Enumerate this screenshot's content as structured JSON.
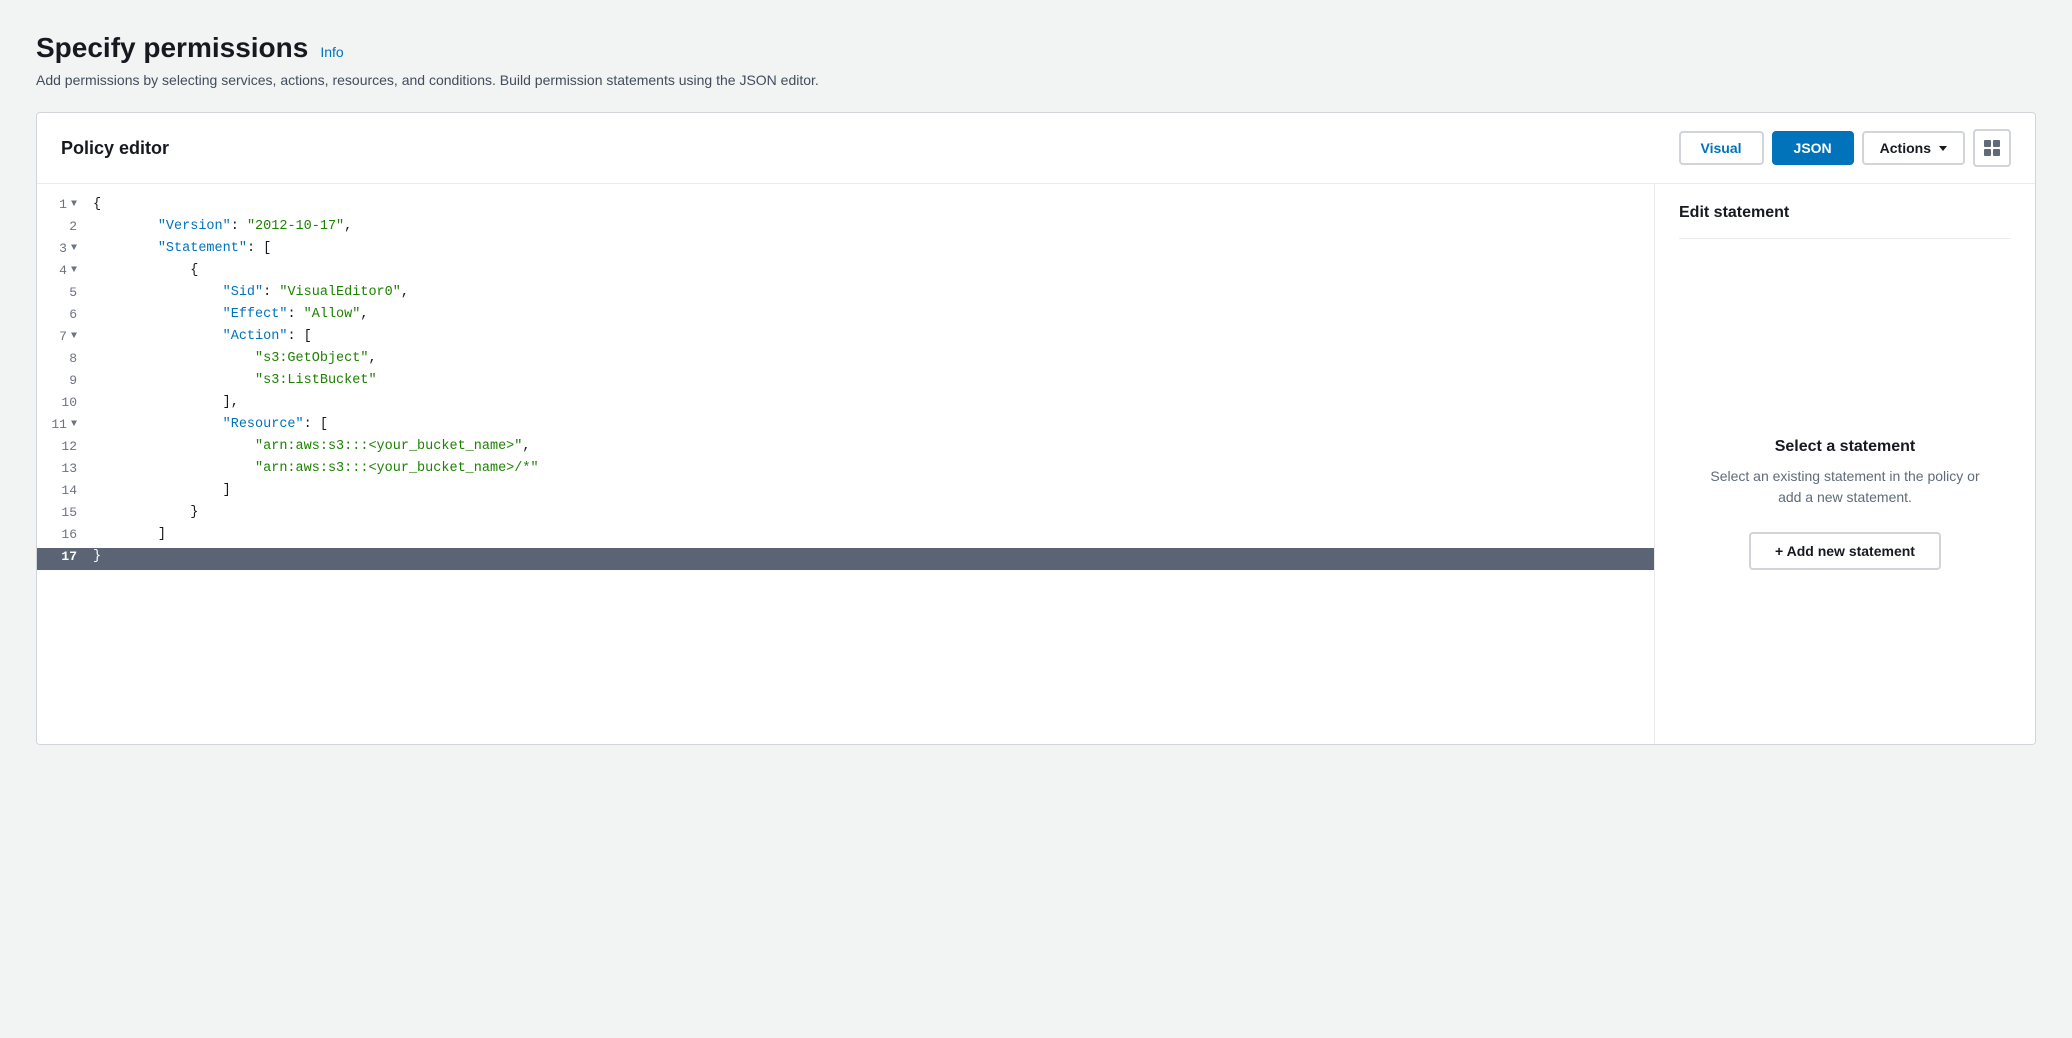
{
  "page": {
    "title": "Specify permissions",
    "info_link": "Info",
    "subtitle": "Add permissions by selecting services, actions, resources, and conditions. Build permission statements using the JSON editor."
  },
  "editor": {
    "title": "Policy editor",
    "tabs": [
      {
        "id": "visual",
        "label": "Visual",
        "active": false
      },
      {
        "id": "json",
        "label": "JSON",
        "active": true
      }
    ],
    "actions_button": "Actions",
    "right_panel": {
      "section_title": "Edit statement",
      "select_heading": "Select a statement",
      "select_desc": "Select an existing statement in the policy or add a new statement.",
      "add_button": "+ Add new statement"
    }
  },
  "code_lines": [
    {
      "num": 1,
      "fold": true,
      "indent": 0,
      "content": "{",
      "highlighted": false
    },
    {
      "num": 2,
      "fold": false,
      "indent": 2,
      "key": "Version",
      "value": "2012-10-17",
      "comma": true
    },
    {
      "num": 3,
      "fold": true,
      "indent": 2,
      "key": "Statement",
      "open_bracket": "[",
      "highlighted": false
    },
    {
      "num": 4,
      "fold": true,
      "indent": 4,
      "content": "{",
      "highlighted": false
    },
    {
      "num": 5,
      "fold": false,
      "indent": 6,
      "key": "Sid",
      "value": "VisualEditor0",
      "comma": true
    },
    {
      "num": 6,
      "fold": false,
      "indent": 6,
      "key": "Effect",
      "value": "Allow",
      "comma": true
    },
    {
      "num": 7,
      "fold": true,
      "indent": 6,
      "key": "Action",
      "open_bracket": "[",
      "highlighted": false
    },
    {
      "num": 8,
      "fold": false,
      "indent": 8,
      "string_value": "s3:GetObject",
      "comma": true
    },
    {
      "num": 9,
      "fold": false,
      "indent": 8,
      "string_value": "s3:ListBucket"
    },
    {
      "num": 10,
      "fold": false,
      "indent": 6,
      "content": "],"
    },
    {
      "num": 11,
      "fold": true,
      "indent": 6,
      "key": "Resource",
      "open_bracket": "[",
      "highlighted": false
    },
    {
      "num": 12,
      "fold": false,
      "indent": 8,
      "string_value": "arn:aws:s3:::<your_bucket_name>",
      "comma": true
    },
    {
      "num": 13,
      "fold": false,
      "indent": 8,
      "string_value": "arn:aws:s3:::<your_bucket_name>/*"
    },
    {
      "num": 14,
      "fold": false,
      "indent": 6,
      "content": "]"
    },
    {
      "num": 15,
      "fold": false,
      "indent": 4,
      "content": "}"
    },
    {
      "num": 16,
      "fold": false,
      "indent": 2,
      "content": "]"
    },
    {
      "num": 17,
      "fold": false,
      "indent": 0,
      "content": "}",
      "highlighted": true
    }
  ]
}
